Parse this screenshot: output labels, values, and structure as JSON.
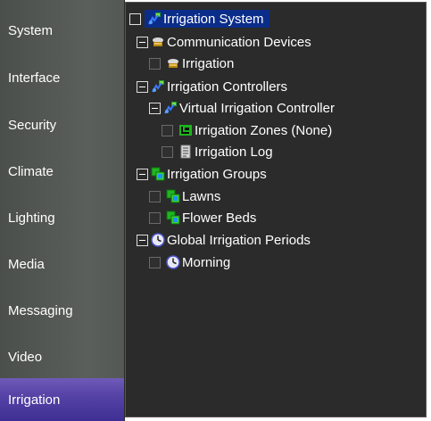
{
  "sidebar": {
    "items": [
      {
        "label": "System",
        "active": false
      },
      {
        "label": "Interface",
        "active": false
      },
      {
        "label": "Security",
        "active": false
      },
      {
        "label": "Climate",
        "active": false
      },
      {
        "label": "Lighting",
        "active": false
      },
      {
        "label": "Media",
        "active": false
      },
      {
        "label": "Messaging",
        "active": false
      },
      {
        "label": "Video",
        "active": false
      },
      {
        "label": "Irrigation",
        "active": true
      }
    ],
    "active_color": "#5643a6"
  },
  "tree": {
    "root": {
      "label": "Irrigation System",
      "icon": "irrigation-system-icon",
      "selected": true
    },
    "communication_devices": {
      "label": "Communication Devices",
      "icon": "communication-devices-icon"
    },
    "comm_irrigation": {
      "label": "Irrigation",
      "icon": "communication-device-icon"
    },
    "irrigation_controllers": {
      "label": "Irrigation Controllers",
      "icon": "irrigation-controller-icon"
    },
    "virtual_controller": {
      "label": "Virtual Irrigation Controller",
      "icon": "irrigation-controller-icon"
    },
    "irrigation_zones": {
      "label": "Irrigation Zones (None)",
      "icon": "zones-icon"
    },
    "irrigation_log": {
      "label": "Irrigation Log",
      "icon": "log-icon"
    },
    "irrigation_groups": {
      "label": "Irrigation Groups",
      "icon": "irrigation-groups-icon"
    },
    "lawns": {
      "label": "Lawns",
      "icon": "group-icon"
    },
    "flower_beds": {
      "label": "Flower Beds",
      "icon": "group-icon"
    },
    "global_periods": {
      "label": "Global Irrigation Periods",
      "icon": "clock-icon"
    },
    "morning": {
      "label": "Morning",
      "icon": "clock-icon"
    }
  }
}
